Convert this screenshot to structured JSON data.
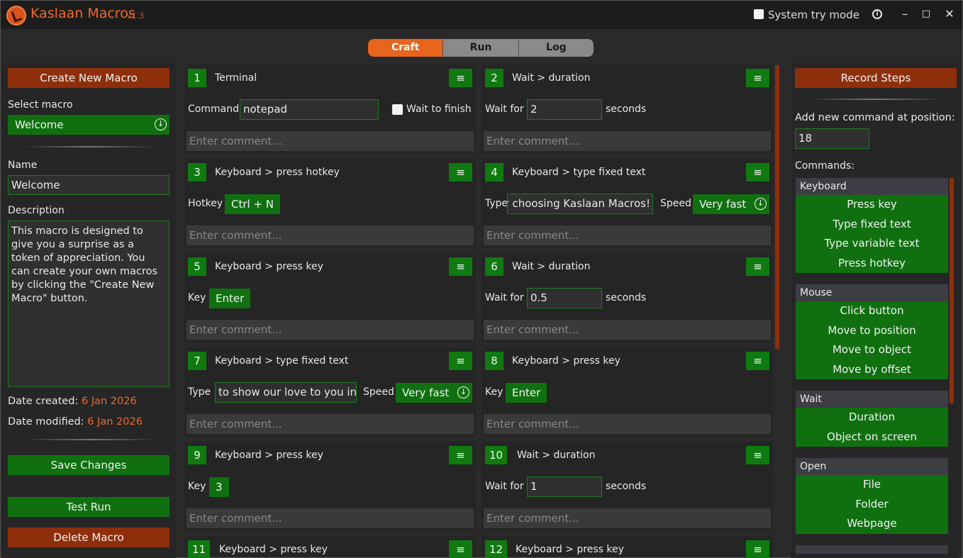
{
  "app": {
    "title": "Kaslaan Macros",
    "version": "v1.3",
    "tray_label": "System try mode",
    "minimize": "–",
    "maximize": "□",
    "close": "✕"
  },
  "tabs": [
    {
      "label": "Craft",
      "active": true
    },
    {
      "label": "Run",
      "active": false
    },
    {
      "label": "Log",
      "active": false
    }
  ],
  "left": {
    "create_label": "Create New Macro",
    "select_label": "Select macro",
    "selected_macro": "Welcome",
    "name_label": "Name",
    "name_value": "Welcome",
    "description_label": "Description",
    "description_value": "This macro is designed to give you a surprise as a token of appreciation. You can create your own macros by clicking the \"Create New Macro\" button.",
    "date_created_label": "Date created:",
    "date_created": "6 Jan 2026",
    "date_modified_label": "Date modified:",
    "date_modified": "6 Jan 2026",
    "save_label": "Save Changes",
    "test_label": "Test Run",
    "delete_label": "Delete Macro"
  },
  "steps": {
    "comment_placeholder": "Enter comment...",
    "menu_icon": "≡",
    "s1": {
      "num": "1",
      "title": "Terminal",
      "label": "Command",
      "value": "notepad",
      "wait_label": "Wait to finish"
    },
    "s2": {
      "num": "2",
      "title": "Wait > duration",
      "label": "Wait for",
      "value": "2",
      "unit": "seconds"
    },
    "s3": {
      "num": "3",
      "title": "Keyboard > press hotkey",
      "label": "Hotkey",
      "value": "Ctrl + N"
    },
    "s4": {
      "num": "4",
      "title": "Keyboard > type fixed text",
      "label": "Type",
      "value": "r choosing Kaslaan Macros!",
      "speed_label": "Speed",
      "speed": "Very fast"
    },
    "s5": {
      "num": "5",
      "title": "Keyboard > press key",
      "label": "Key",
      "value": "Enter"
    },
    "s6": {
      "num": "6",
      "title": "Wait > duration",
      "label": "Wait for",
      "value": "0.5",
      "unit": "seconds"
    },
    "s7": {
      "num": "7",
      "title": "Keyboard > type fixed text",
      "label": "Type",
      "value": "to show our love to you in",
      "speed_label": "Speed",
      "speed": "Very fast"
    },
    "s8": {
      "num": "8",
      "title": "Keyboard > press key",
      "label": "Key",
      "value": "Enter"
    },
    "s9": {
      "num": "9",
      "title": "Keyboard > press key",
      "label": "Key",
      "value": "3"
    },
    "s10": {
      "num": "10",
      "title": "Wait > duration",
      "label": "Wait for",
      "value": "1",
      "unit": "seconds"
    },
    "s11": {
      "num": "11",
      "title": "Keyboard > press key"
    },
    "s12": {
      "num": "12",
      "title": "Keyboard > press key"
    }
  },
  "right": {
    "record_label": "Record Steps",
    "position_label": "Add new command at position:",
    "position_value": "18",
    "commands_label": "Commands:",
    "categories": [
      {
        "name": "Keyboard",
        "items": [
          "Press key",
          "Type fixed text",
          "Type variable text",
          "Press hotkey"
        ]
      },
      {
        "name": "Mouse",
        "items": [
          "Click button",
          "Move to position",
          "Move to object",
          "Move by offset"
        ]
      },
      {
        "name": "Wait",
        "items": [
          "Duration",
          "Object on screen"
        ]
      },
      {
        "name": "Open",
        "items": [
          "File",
          "Folder",
          "Webpage"
        ]
      }
    ]
  },
  "colors": {
    "accent_orange": "#e8641c",
    "dark_orange": "#8e2f0c",
    "green": "#107010"
  }
}
